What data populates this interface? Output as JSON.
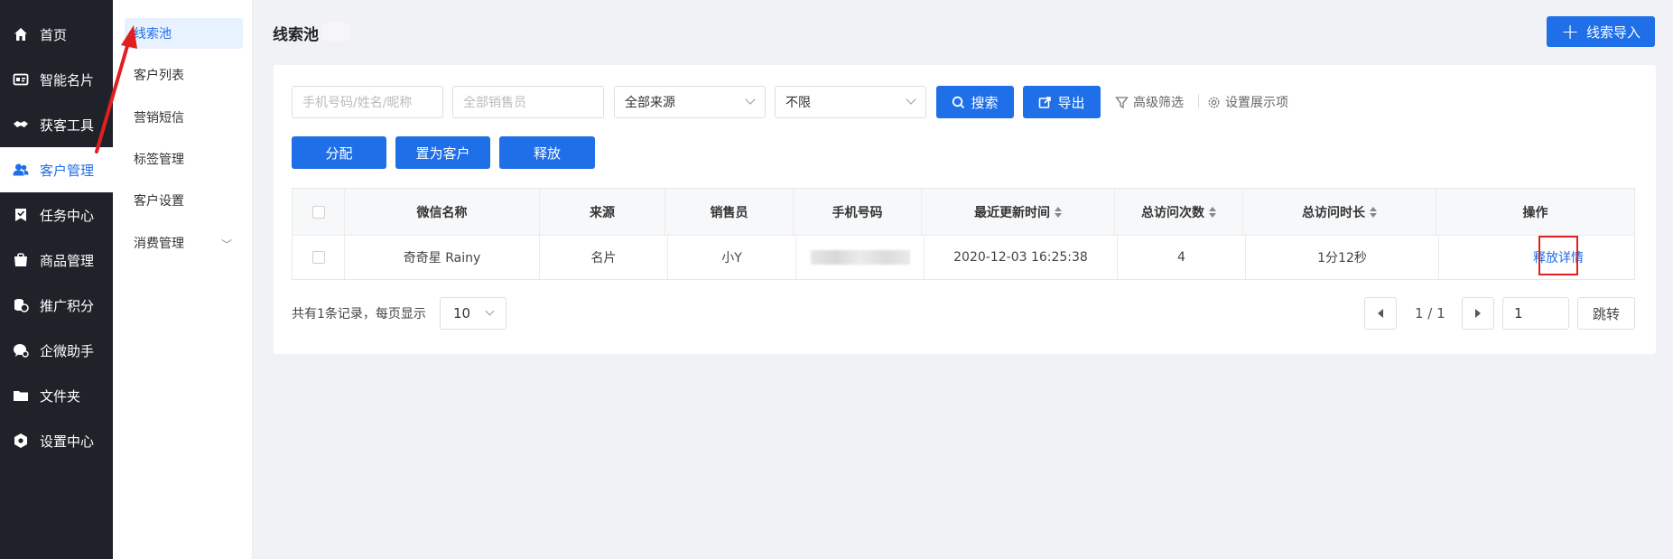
{
  "sidebar": {
    "items": [
      {
        "label": "首页",
        "icon": "home-icon"
      },
      {
        "label": "智能名片",
        "icon": "card-icon"
      },
      {
        "label": "获客工具",
        "icon": "handshake-icon"
      },
      {
        "label": "客户管理",
        "icon": "users-icon",
        "active": true
      },
      {
        "label": "任务中心",
        "icon": "task-icon"
      },
      {
        "label": "商品管理",
        "icon": "shop-icon"
      },
      {
        "label": "推广积分",
        "icon": "coins-icon"
      },
      {
        "label": "企微助手",
        "icon": "chat-icon"
      },
      {
        "label": "文件夹",
        "icon": "folder-icon"
      },
      {
        "label": "设置中心",
        "icon": "settings-icon"
      }
    ]
  },
  "submenu": {
    "items": [
      {
        "label": "线索池",
        "active": true
      },
      {
        "label": "客户列表"
      },
      {
        "label": "营销短信"
      },
      {
        "label": "标签管理"
      },
      {
        "label": "客户设置"
      },
      {
        "label": "消费管理",
        "has_children": true
      }
    ]
  },
  "header": {
    "title": "线索池",
    "import_label": "线索导入"
  },
  "filters": {
    "search_placeholder": "手机号码/姓名/昵称",
    "sales_placeholder": "全部销售员",
    "source_value": "全部来源",
    "limit_value": "不限",
    "search_label": "搜索",
    "export_label": "导出",
    "advanced_label": "高级筛选",
    "display_label": "设置展示项"
  },
  "actions": {
    "assign": "分配",
    "to_customer": "置为客户",
    "release": "释放"
  },
  "table": {
    "headers": [
      "微信名称",
      "来源",
      "销售员",
      "手机号码",
      "最近更新时间",
      "总访问次数",
      "总访问时长",
      "操作"
    ],
    "rows": [
      {
        "wechat_name": "奇奇星 Rainy",
        "source": "名片",
        "sales": "小Y",
        "phone": "",
        "updated": "2020-12-03 16:25:38",
        "visits": "4",
        "duration": "1分12秒",
        "op_release": "释放",
        "op_detail": "详情"
      }
    ]
  },
  "pagination": {
    "summary": "共有1条记录，每页显示",
    "page_size": "10",
    "page_info": "1 / 1",
    "jump_value": "1",
    "jump_label": "跳转"
  },
  "colors": {
    "accent": "#1e6fe8",
    "sidebar_bg": "#1f2229",
    "annotation": "#e02020"
  }
}
